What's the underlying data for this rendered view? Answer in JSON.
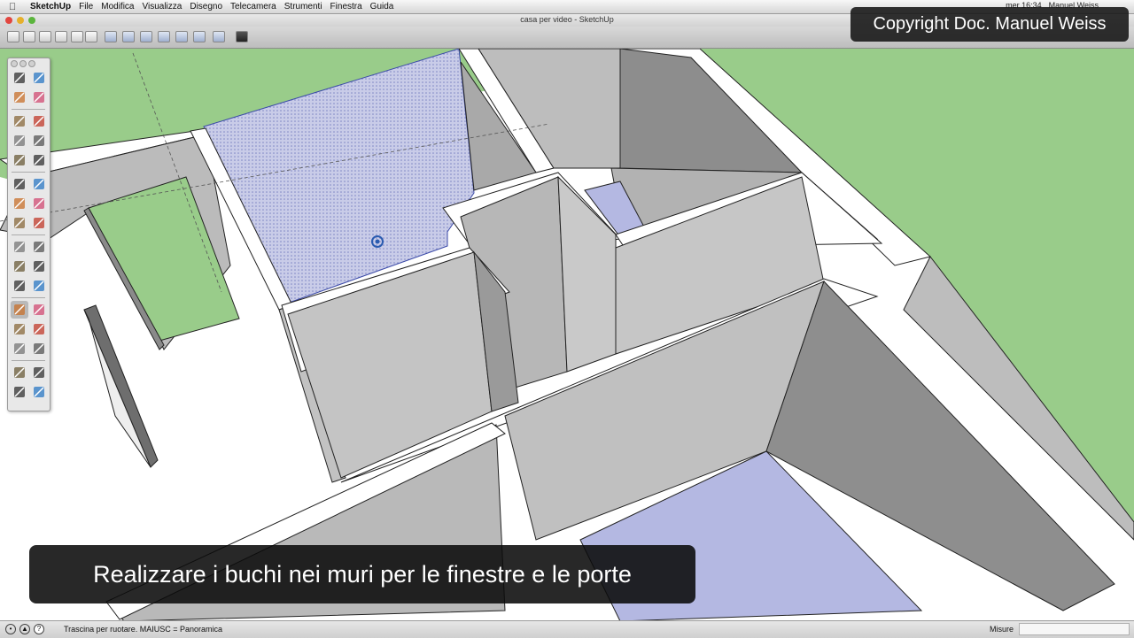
{
  "menubar": {
    "app_name": "SketchUp",
    "items": [
      "File",
      "Modifica",
      "Visualizza",
      "Disegno",
      "Telecamera",
      "Strumenti",
      "Finestra",
      "Guida"
    ],
    "clock": "mer 16:34",
    "user": "Manuel Weiss"
  },
  "window": {
    "title": "casa per video - SketchUp"
  },
  "overlay": {
    "copyright": "Copyright Doc. Manuel Weiss",
    "subtitle": "Realizzare i buchi nei muri per le finestre e le porte"
  },
  "statusbar": {
    "text": "Trascina per ruotare.  MAIUSC = Panoramica",
    "measure_label": "Misure",
    "measure_value": ""
  },
  "palette": {
    "tools": [
      "select-icon",
      "component-icon",
      "paint-bucket-icon",
      "eraser-icon",
      "rectangle-icon",
      "line-icon",
      "circle-icon",
      "arc-icon",
      "polygon-icon",
      "freehand-icon",
      "move-icon",
      "push-pull-icon",
      "rotate-icon",
      "follow-me-icon",
      "scale-icon",
      "offset-icon",
      "tape-measure-icon",
      "dimension-icon",
      "protractor-icon",
      "text-icon",
      "axes-icon",
      "3d-text-icon",
      "orbit-icon",
      "pan-icon",
      "zoom-icon",
      "zoom-window-icon",
      "zoom-extents-icon",
      "previous-view-icon",
      "position-camera-icon",
      "walk-icon",
      "look-around-icon",
      "section-plane-icon"
    ],
    "selected": "orbit-icon"
  },
  "colors": {
    "grass": "#99cc8a",
    "wall_top": "#ffffff",
    "wall_face": "#b4b4b4",
    "floor_blue": "#b4b8e2",
    "selection_hatch": "#8f95cf"
  }
}
